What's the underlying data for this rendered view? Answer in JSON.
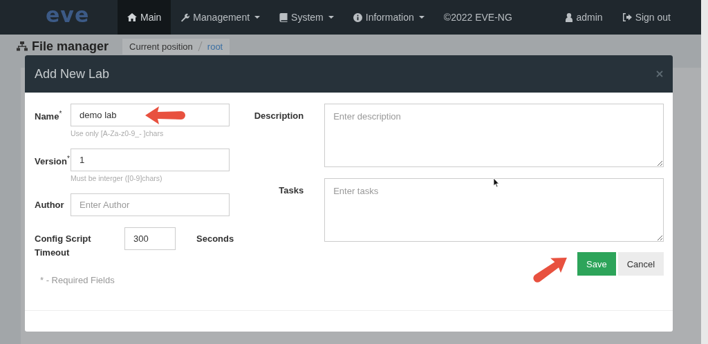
{
  "navbar": {
    "logo": "eve",
    "items": [
      {
        "label": "Main",
        "dropdown": false,
        "selected": true
      },
      {
        "label": "Management",
        "dropdown": true,
        "selected": false
      },
      {
        "label": "System",
        "dropdown": true,
        "selected": false
      },
      {
        "label": "Information",
        "dropdown": true,
        "selected": false
      },
      {
        "label": "©2022 EVE-NG",
        "dropdown": false,
        "selected": false
      }
    ],
    "right_items": [
      {
        "label": "admin"
      },
      {
        "label": "Sign out"
      }
    ]
  },
  "page": {
    "title": "File manager",
    "breadcrumb": [
      "Current position",
      "root"
    ]
  },
  "modal": {
    "title": "Add New Lab",
    "fields": [
      {
        "label": "Name$^{*}$",
        "value": "demo lab",
        "hint": "Use only [A-Za-z0-9_- ]chars"
      },
      {
        "label": "Version$^{*}$",
        "value": "1",
        "hint": "Must be interger ([0-9]chars)"
      },
      {
        "label": "Author",
        "placeholder": "Enter Author"
      }
    ],
    "timeout": {
      "label": "Config Script Timeout",
      "value": "300",
      "unit": "Seconds"
    },
    "required_note": "* - Required Fields",
    "textareas": [
      {
        "label": "Description",
        "placeholder": "Enter description"
      },
      {
        "label": "Tasks",
        "placeholder": "Enter tasks"
      }
    ],
    "buttons": [
      {
        "label": "Save",
        "kind": "primary"
      },
      {
        "label": "Cancel",
        "kind": "default"
      }
    ]
  }
}
